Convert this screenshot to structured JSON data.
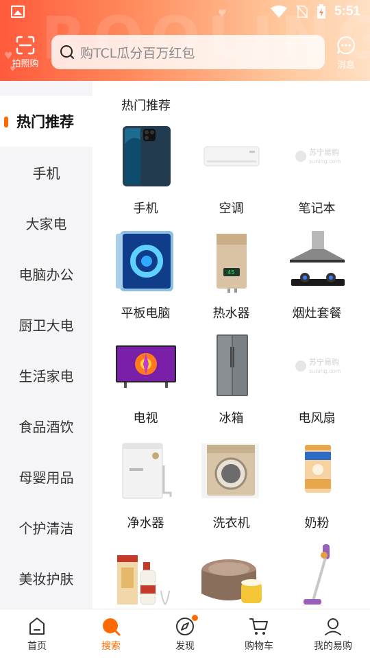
{
  "status_bar": {
    "time": "5:51"
  },
  "header": {
    "scan_label": "拍照购",
    "search_placeholder": "购TCL瓜分百万红包",
    "message_label": "消息"
  },
  "sidebar": {
    "active": "热门推荐",
    "items": [
      "手机",
      "大家电",
      "电脑办公",
      "厨卫大电",
      "生活家电",
      "食品酒饮",
      "母婴用品",
      "个护清洁",
      "美妆护肤"
    ]
  },
  "content": {
    "section_title": "热门推荐",
    "items": [
      {
        "label": "手机",
        "icon": "phone-image"
      },
      {
        "label": "空调",
        "icon": "air-conditioner-image"
      },
      {
        "label": "笔记本",
        "icon": "suning-placeholder-image"
      },
      {
        "label": "平板电脑",
        "icon": "tablet-image"
      },
      {
        "label": "热水器",
        "icon": "water-heater-image"
      },
      {
        "label": "烟灶套餐",
        "icon": "range-hood-image"
      },
      {
        "label": "电视",
        "icon": "tv-image"
      },
      {
        "label": "冰箱",
        "icon": "fridge-image"
      },
      {
        "label": "电风扇",
        "icon": "suning-placeholder-image"
      },
      {
        "label": "净水器",
        "icon": "water-purifier-image"
      },
      {
        "label": "洗衣机",
        "icon": "washing-machine-image"
      },
      {
        "label": "奶粉",
        "icon": "milk-powder-image"
      },
      {
        "label": "",
        "icon": "liquor-image"
      },
      {
        "label": "",
        "icon": "rice-cooker-image"
      },
      {
        "label": "",
        "icon": "vacuum-image"
      }
    ],
    "placeholder_logo_cn": "苏宁易购",
    "placeholder_logo_en": "suning.com"
  },
  "bottom_nav": {
    "items": [
      {
        "label": "首页"
      },
      {
        "label": "搜索"
      },
      {
        "label": "发现"
      },
      {
        "label": "购物车"
      },
      {
        "label": "我的易购"
      }
    ],
    "active_index": 1
  },
  "colors": {
    "accent": "#ff6a00",
    "header_start": "#ff5a3c",
    "header_end": "#ffe0c4"
  }
}
